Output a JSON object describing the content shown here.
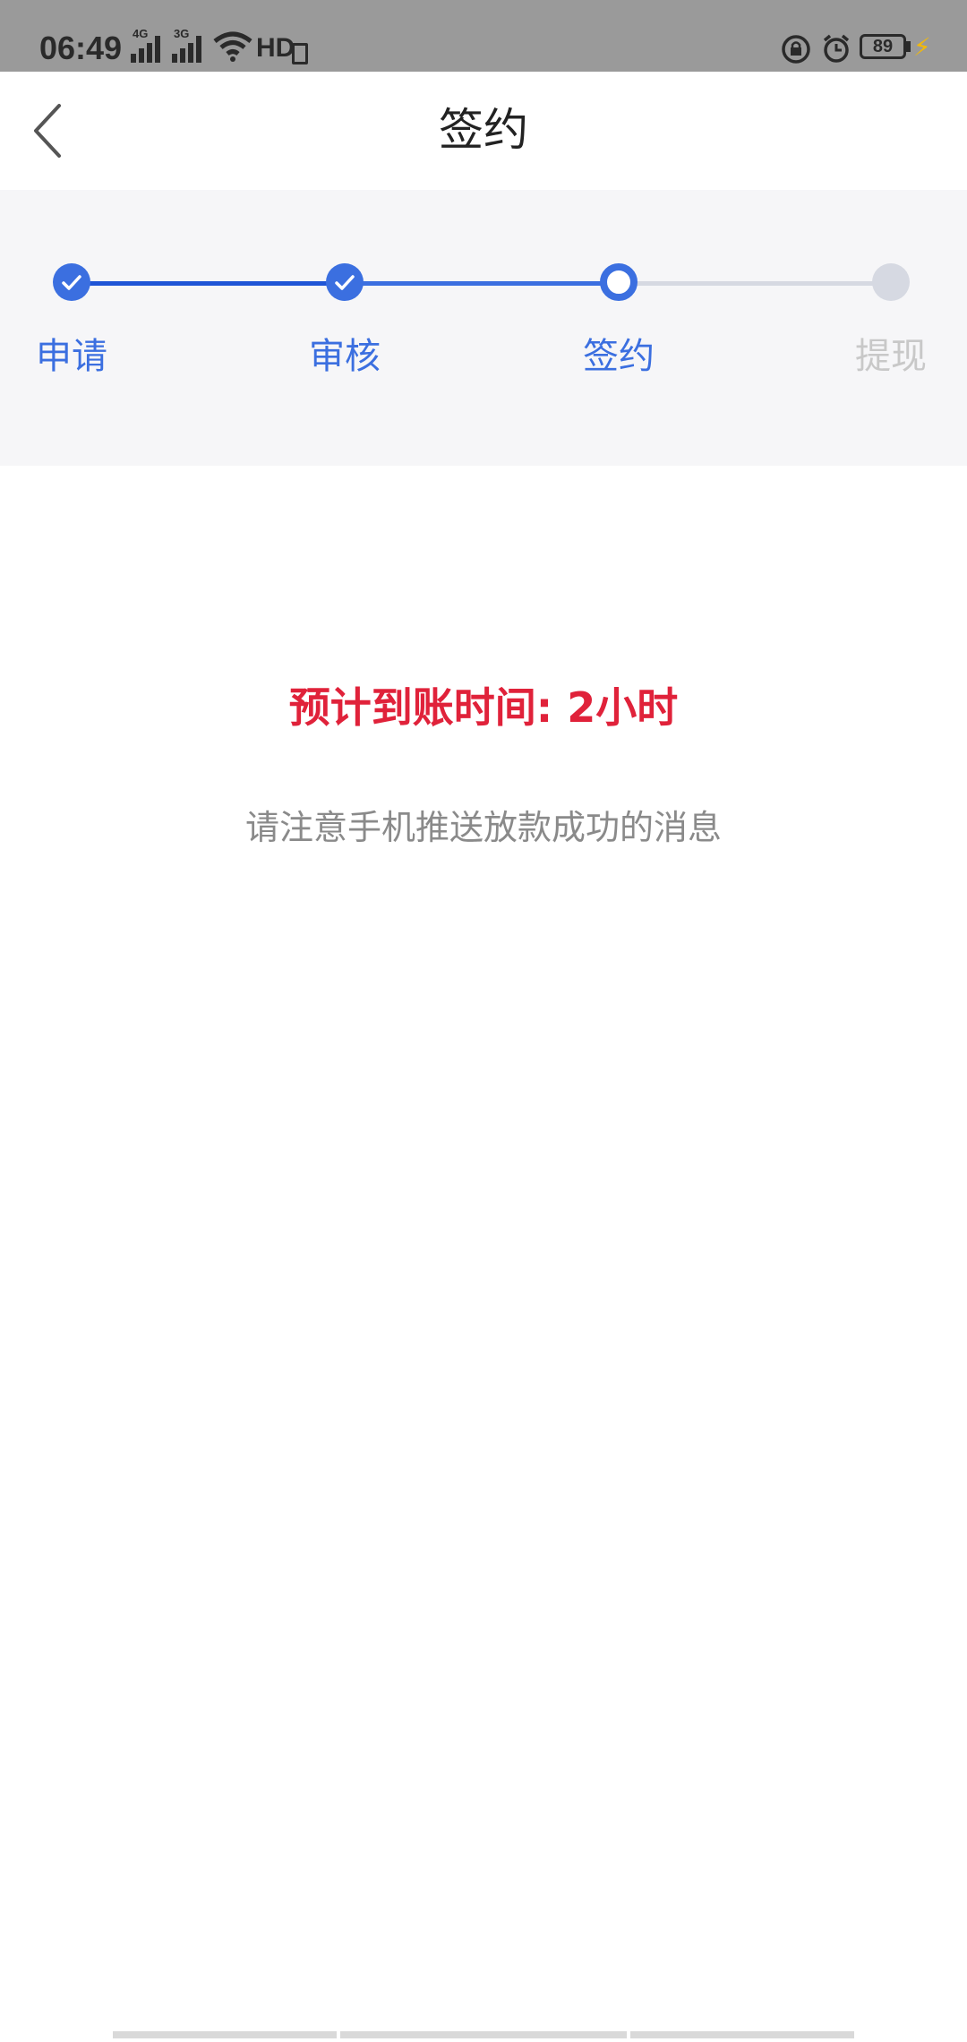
{
  "status_bar": {
    "time": "06:49",
    "network_1": "4G",
    "network_2": "3G",
    "hd_label": "HD",
    "battery_level": "89"
  },
  "nav": {
    "title": "签约"
  },
  "steps": [
    {
      "label": "申请",
      "state": "done"
    },
    {
      "label": "审核",
      "state": "done"
    },
    {
      "label": "签约",
      "state": "current"
    },
    {
      "label": "提现",
      "state": "pending"
    }
  ],
  "main": {
    "eta_text": "预计到账时间: 2小时",
    "tip_text": "请注意手机推送放款成功的消息"
  },
  "colors": {
    "accent": "#3b6fe0",
    "accent_dark": "#1f55d6",
    "pending": "#d6d9e2",
    "pending_label": "#c8c8c8",
    "eta": "#e0223a"
  }
}
